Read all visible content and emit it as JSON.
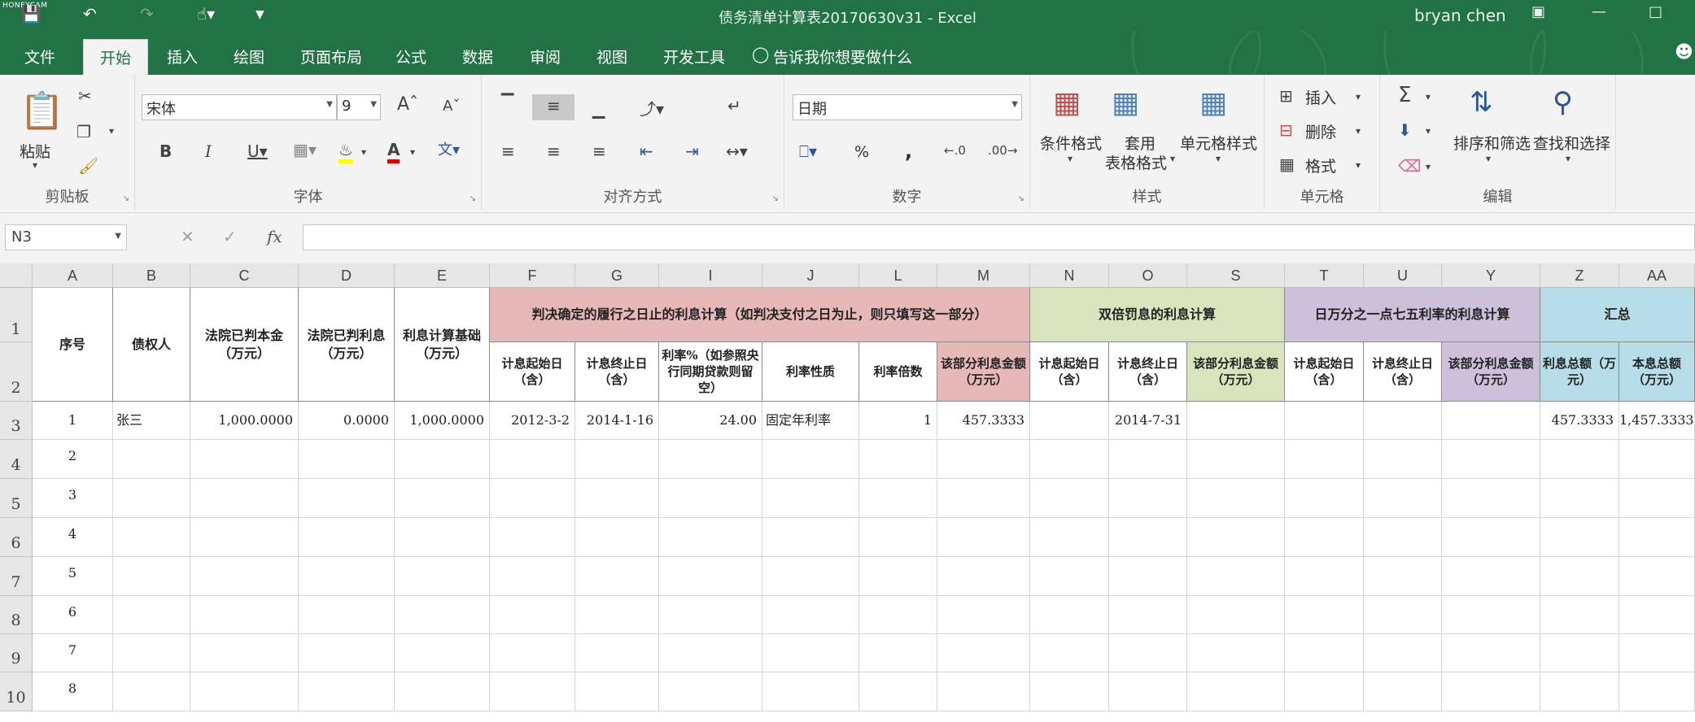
{
  "title_bar": {
    "title": "债务清单计算表20170630v31  -  Excel",
    "user": "bryan chen",
    "watermark": "HONEYCAM"
  },
  "ribbon_tabs": [
    "文件",
    "开始",
    "插入",
    "绘图",
    "页面布局",
    "公式",
    "数据",
    "审阅",
    "视图",
    "开发工具"
  ],
  "tell_me": "告诉我你想要做什么",
  "clipboard": {
    "paste": "粘贴",
    "group": "剪贴板"
  },
  "font": {
    "name": "宋体",
    "size": "9",
    "group": "字体"
  },
  "alignment": {
    "group": "对齐方式"
  },
  "number": {
    "format": "日期",
    "group": "数字",
    "percent": "%",
    "comma": ","
  },
  "styles": {
    "conditional": "条件格式",
    "table1": "套用",
    "table2": "表格格式",
    "cell_styles": "单元格样式",
    "group": "样式"
  },
  "cells": {
    "insert": "插入",
    "delete": "删除",
    "format": "格式",
    "group": "单元格"
  },
  "editing": {
    "sort": "排序和筛选",
    "find": "查找和选择",
    "group": "编辑"
  },
  "formula_bar": {
    "name_box": "N3",
    "fx": "fx",
    "value": ""
  },
  "columns": [
    "A",
    "B",
    "C",
    "D",
    "E",
    "F",
    "G",
    "I",
    "J",
    "L",
    "M",
    "N",
    "O",
    "S",
    "T",
    "U",
    "Y",
    "Z",
    "AA"
  ],
  "rows": [
    "1",
    "2",
    "3",
    "4",
    "5",
    "6",
    "7",
    "8",
    "9",
    "10"
  ],
  "headers": {
    "seq": "序号",
    "creditor": "债权人",
    "principal": "法院已判本金（万元）",
    "interest": "法院已判利息（万元）",
    "base": "利息计算基础（万元）",
    "group1": "判决确定的履行之日止的利息计算（如判决支付之日为止，则只填写这一部分）",
    "g1": [
      "计息起始日（含）",
      "计息终止日（含）",
      "利率%（如参照央行同期贷款则留空）",
      "利率性质",
      "利率倍数",
      "该部分利息金额（万元）"
    ],
    "group2": "双倍罚息的利息计算",
    "g2": [
      "计息起始日（含）",
      "计息终止日（含）",
      "该部分利息金额（万元）"
    ],
    "group3": "日万分之一点七五利率的利息计算",
    "g3": [
      "计息起始日（含）",
      "计息终止日（含）",
      "该部分利息金额（万元）"
    ],
    "group4": "汇总",
    "g4": [
      "利息总额（万元）",
      "本息总额（万元）"
    ]
  },
  "data_row": [
    "1",
    "张三",
    "1,000.0000",
    "0.0000",
    "1,000.0000",
    "2012-3-2",
    "2014-1-16",
    "24.00",
    "固定年利率",
    "1",
    "457.3333",
    "",
    "2014-7-31",
    "",
    "",
    "",
    "",
    "457.3333",
    "1,457.3333"
  ],
  "seq_rest": [
    "2",
    "3",
    "4",
    "5",
    "6",
    "7",
    "8"
  ],
  "colors": {
    "excel_green": "#217346",
    "group1": "#e6b8b7",
    "group2": "#d8e4bc",
    "group3": "#ccc0da",
    "group4": "#b7dee8"
  }
}
